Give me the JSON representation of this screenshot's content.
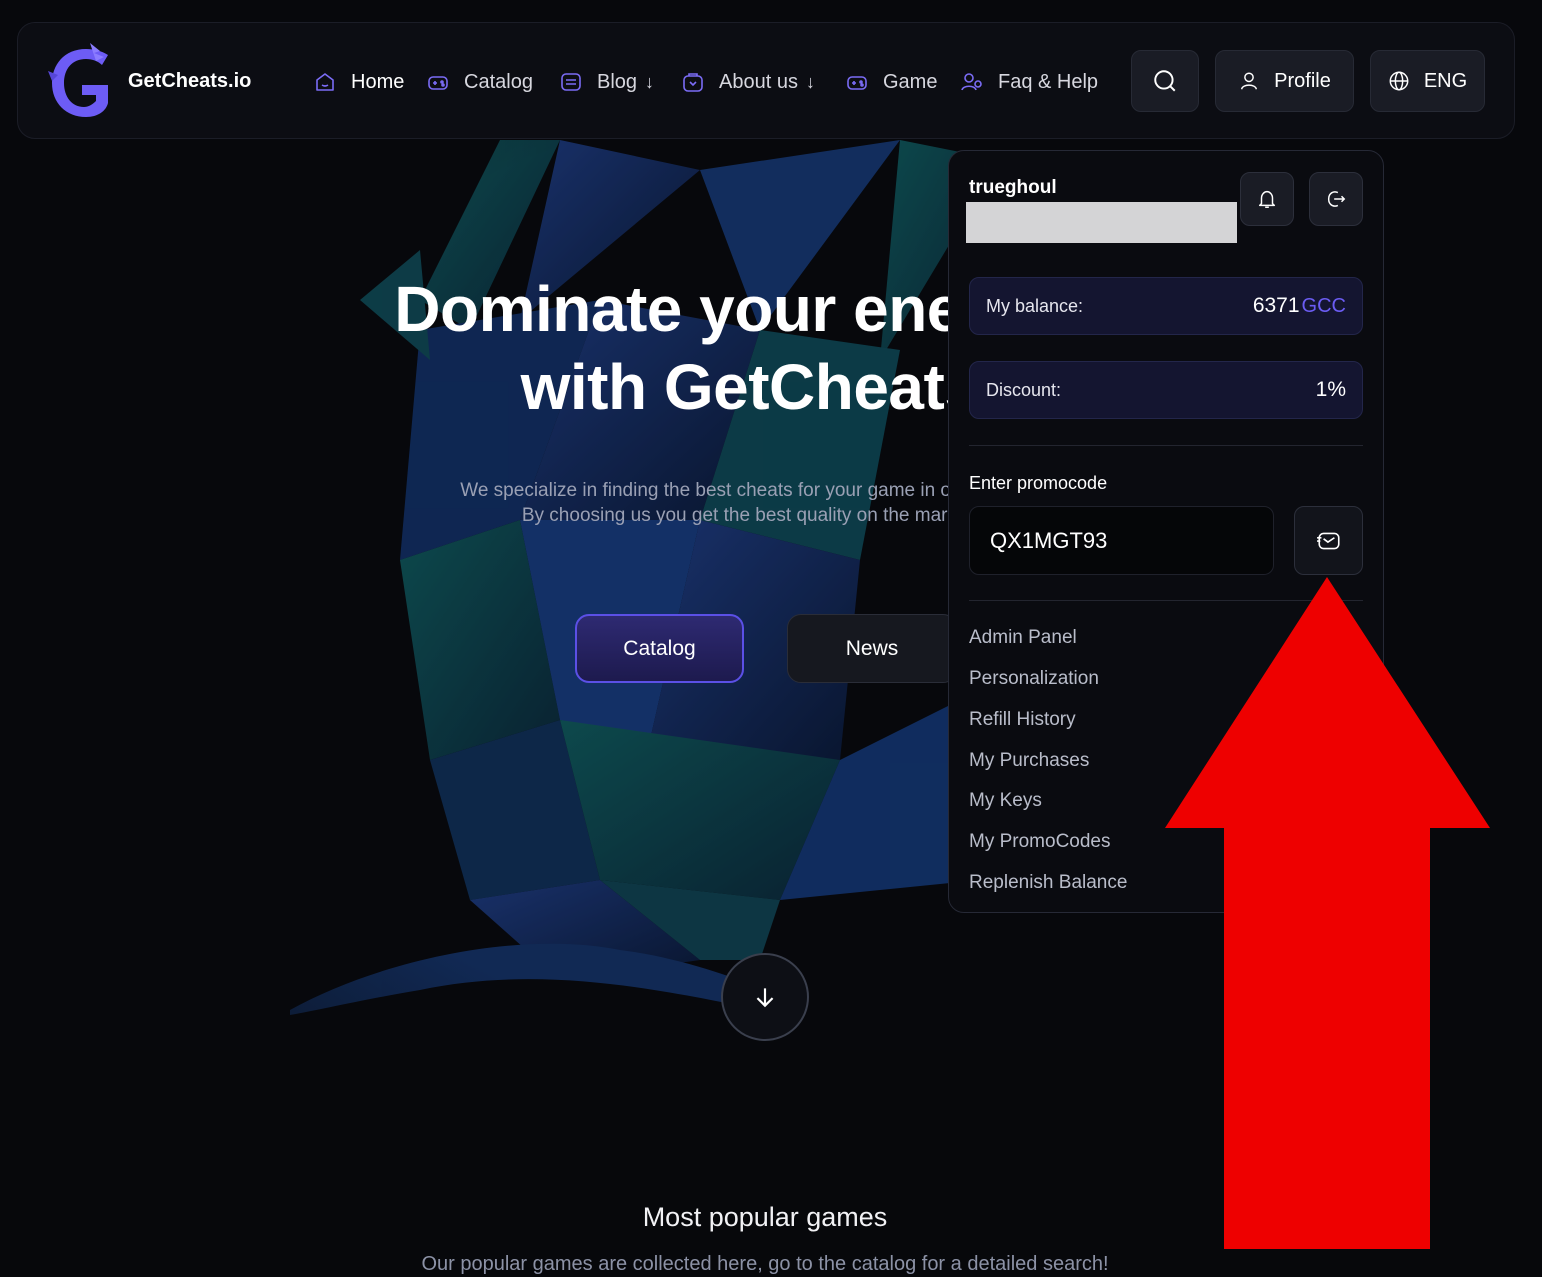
{
  "header": {
    "brand": "GetCheats.io",
    "nav": [
      {
        "label": "Home",
        "icon": "home-icon",
        "has_dropdown": false
      },
      {
        "label": "Catalog",
        "icon": "gamepad-icon",
        "has_dropdown": false
      },
      {
        "label": "Blog",
        "icon": "blog-icon",
        "has_dropdown": true
      },
      {
        "label": "About us",
        "icon": "info-bag-icon",
        "has_dropdown": true
      },
      {
        "label": "Game",
        "icon": "gamepad-icon",
        "has_dropdown": false
      },
      {
        "label": "Faq & Help",
        "icon": "users-icon",
        "has_dropdown": false
      }
    ],
    "dropdown_arrow": "↓",
    "search_icon": "search-icon",
    "profile_label": "Profile",
    "language_label": "ENG"
  },
  "hero": {
    "title_line1": "Dominate your enemies",
    "title_line2": "with GetCheats",
    "subtitle_line1": "We specialize in finding the best cheats for your game in our catalog.",
    "subtitle_line2": "By choosing us you get the best quality on the market.",
    "catalog_button": "Catalog",
    "news_button": "News"
  },
  "popular": {
    "title": "Most popular games",
    "subtitle": "Our popular games are collected here, go to the catalog for a detailed search!"
  },
  "dropdown": {
    "username": "trueghoul",
    "balance_label": "My balance:",
    "balance_value": "6371",
    "balance_currency": "GCC",
    "discount_label": "Discount:",
    "discount_value": "1%",
    "promo_label": "Enter promocode",
    "promo_value": "QX1MGT93",
    "menu": [
      "Admin Panel",
      "Personalization",
      "Refill History",
      "My Purchases",
      "My Keys",
      "My PromoCodes",
      "Replenish Balance"
    ]
  },
  "colors": {
    "accent": "#6b5cf2",
    "annotation_arrow": "#ee0000",
    "background": "#07080c"
  }
}
